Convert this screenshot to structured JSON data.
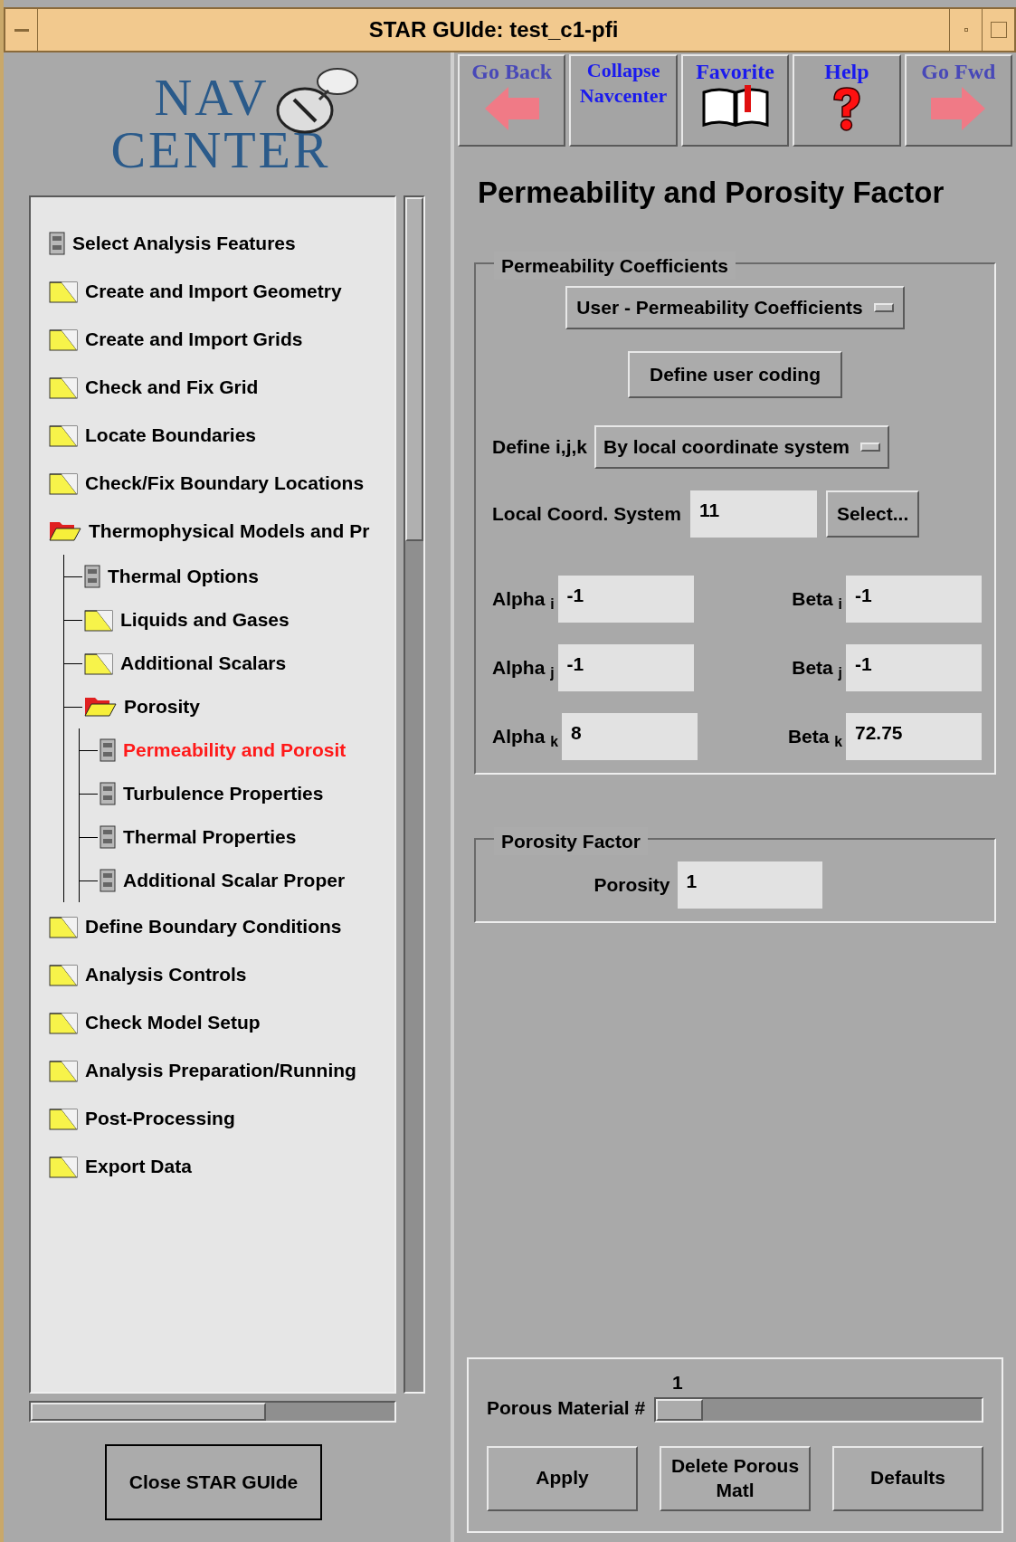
{
  "window": {
    "title": "STAR GUIde: test_c1-pfi"
  },
  "logo": {
    "line_1": "NAV",
    "line_2": "CENTER"
  },
  "tree": [
    {
      "label": "Select Analysis Features",
      "kind": "doc",
      "selected": false
    },
    {
      "label": "Create and Import Geometry",
      "kind": "folder",
      "expanded": false,
      "selected": false
    },
    {
      "label": "Create and Import Grids",
      "kind": "folder",
      "expanded": false,
      "selected": false
    },
    {
      "label": "Check and Fix Grid",
      "kind": "folder",
      "expanded": false,
      "selected": false
    },
    {
      "label": "Locate Boundaries",
      "kind": "folder",
      "expanded": false,
      "selected": false
    },
    {
      "label": "Check/Fix Boundary Locations",
      "kind": "folder",
      "expanded": false,
      "selected": false
    },
    {
      "label": "Thermophysical Models and Pr",
      "kind": "folder",
      "expanded": true,
      "selected": false,
      "children": [
        {
          "label": "Thermal Options",
          "kind": "doc",
          "selected": false
        },
        {
          "label": "Liquids and Gases",
          "kind": "folder",
          "expanded": false,
          "selected": false
        },
        {
          "label": "Additional Scalars",
          "kind": "folder",
          "expanded": false,
          "selected": false
        },
        {
          "label": "Porosity",
          "kind": "folder",
          "expanded": true,
          "selected": false,
          "children": [
            {
              "label": "Permeability and Porosit",
              "kind": "doc",
              "selected": true
            },
            {
              "label": "Turbulence Properties",
              "kind": "doc",
              "selected": false
            },
            {
              "label": "Thermal Properties",
              "kind": "doc",
              "selected": false
            },
            {
              "label": "Additional Scalar Proper",
              "kind": "doc",
              "selected": false
            }
          ]
        }
      ]
    },
    {
      "label": "Define Boundary Conditions",
      "kind": "folder",
      "expanded": false,
      "selected": false
    },
    {
      "label": "Analysis Controls",
      "kind": "folder",
      "expanded": false,
      "selected": false
    },
    {
      "label": "Check Model Setup",
      "kind": "folder",
      "expanded": false,
      "selected": false
    },
    {
      "label": "Analysis Preparation/Running",
      "kind": "folder",
      "expanded": false,
      "selected": false
    },
    {
      "label": "Post-Processing",
      "kind": "folder",
      "expanded": false,
      "selected": false
    },
    {
      "label": "Export Data",
      "kind": "folder",
      "expanded": false,
      "selected": false
    }
  ],
  "close_button": "Close STAR GUIde",
  "toolbar": [
    {
      "label": "Go Back",
      "kind": "back",
      "disabled": true
    },
    {
      "label": "Collapse Navcenter",
      "kind": "collapse",
      "disabled": false
    },
    {
      "label": "Favorite",
      "kind": "favorite",
      "disabled": false
    },
    {
      "label": "Help",
      "kind": "help",
      "disabled": false
    },
    {
      "label": "Go Fwd",
      "kind": "forward",
      "disabled": true
    }
  ],
  "page_title": "Permeability and Porosity Factor",
  "permeability_group": {
    "title": "Permeability Coefficients",
    "method_dropdown": "User - Permeability Coefficients",
    "define_button": "Define user coding",
    "ijk_label": "Define i,j,k",
    "ijk_dropdown": "By local coordinate system",
    "coord_label": "Local Coord. System",
    "coord_value": "11",
    "select_button": "Select...",
    "coefficients": [
      {
        "label": "Alpha $_{i}$",
        "value": "-1"
      },
      {
        "label": "Beta $_{i}$",
        "value": "-1"
      },
      {
        "label": "Alpha $_{j}$",
        "value": "-1"
      },
      {
        "label": "Beta $_{j}$",
        "value": "-1"
      },
      {
        "label": "Alpha $_{k}$",
        "value": "8"
      },
      {
        "label": "Beta $_{k}$",
        "value": "72.75"
      }
    ]
  },
  "porosity_group": {
    "title": "Porosity Factor",
    "label": "Porosity",
    "value": "1"
  },
  "material": {
    "label": "Porous Material #",
    "reading": "1",
    "level": 0
  },
  "buttons": [
    "Apply",
    "Delete Porous Matl",
    "Defaults"
  ]
}
